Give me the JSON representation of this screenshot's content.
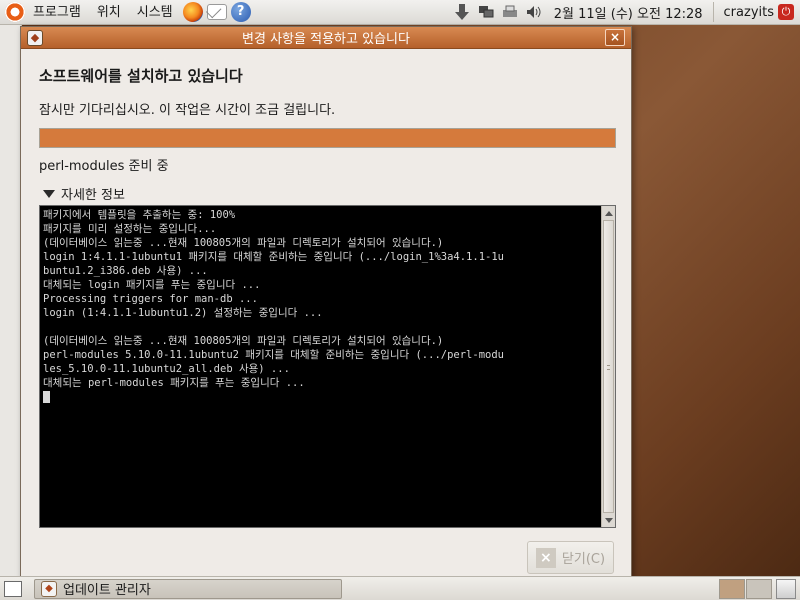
{
  "top_panel": {
    "menus": [
      "프로그램",
      "위치",
      "시스템"
    ],
    "clock": "2월 11일 (수) 오전 12:28",
    "user": "crazyits",
    "help_glyph": "?"
  },
  "dialog": {
    "title": "변경 사항을 적용하고 있습니다",
    "heading": "소프트웨어를 설치하고 있습니다",
    "subtitle": "잠시만 기다리십시오. 이 작업은 시간이 조금 걸립니다.",
    "progress_percent": 100,
    "status": "perl-modules 준비 중",
    "details_label": "자세한 정보",
    "terminal_lines": [
      "패키지에서 템플릿을 추출하는 중: 100%",
      "패키지를 미리 설정하는 중입니다...",
      "(데이터베이스 읽는중 ...현재 100805개의 파일과 디렉토리가 설치되어 있습니다.)",
      "login 1:4.1.1-1ubuntu1 패키지를 대체할 준비하는 중입니다 (.../login_1%3a4.1.1-1u",
      "buntu1.2_i386.deb 사용) ...",
      "대체되는 login 패키지를 푸는 중입니다 ...",
      "Processing triggers for man-db ...",
      "login (1:4.1.1-1ubuntu1.2) 설정하는 중입니다 ...",
      "",
      "(데이터베이스 읽는중 ...현재 100805개의 파일과 디렉토리가 설치되어 있습니다.)",
      "perl-modules 5.10.0-11.1ubuntu2 패키지를 대체할 준비하는 중입니다 (.../perl-modu",
      "les_5.10.0-11.1ubuntu2_all.deb 사용) ...",
      "대체되는 perl-modules 패키지를 푸는 중입니다 ..."
    ],
    "close_button": "닫기(C)",
    "close_glyph": "×"
  },
  "bottom_panel": {
    "task_title": "업데이트 관리자"
  },
  "colors": {
    "accent": "#d57a3c",
    "titlebar": "#c06a32"
  }
}
